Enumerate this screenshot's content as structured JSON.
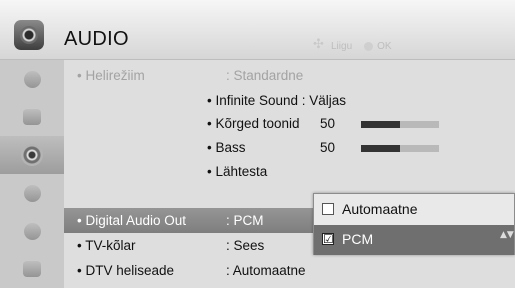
{
  "header": {
    "title": "AUDIO",
    "hint_move": "Liigu",
    "hint_ok": "OK",
    "hint_move_icon": "four-way-arrows-icon",
    "hint_ok_icon": "ok-button-icon"
  },
  "sidebar": {
    "items": [
      {
        "icon": "setup-icon",
        "active": false
      },
      {
        "icon": "picture-icon",
        "active": false
      },
      {
        "icon": "audio-icon",
        "active": true
      },
      {
        "icon": "time-icon",
        "active": false
      },
      {
        "icon": "lock-icon",
        "active": false
      },
      {
        "icon": "option-icon",
        "active": false
      }
    ]
  },
  "menu": {
    "rows": [
      {
        "label": "• Helirežiim",
        "value": ": Standardne",
        "state": "dimmed"
      },
      {
        "label": "• Digital Audio Out",
        "value": ": PCM",
        "state": "selected"
      },
      {
        "label": "• TV-kõlar",
        "value": ": Sees",
        "state": "normal"
      },
      {
        "label": "• DTV heliseade",
        "value": ": Automaatne",
        "state": "normal"
      }
    ],
    "sub_items": [
      {
        "text": "• Infinite Sound : Väljas"
      },
      {
        "text": "• Kõrged toonid",
        "number": "50",
        "level": 50
      },
      {
        "text": "• Bass",
        "number": "50",
        "level": 50
      },
      {
        "text": "• Lähtesta"
      }
    ]
  },
  "popup": {
    "options": [
      {
        "label": "Automaatne",
        "checked": false,
        "selected": false
      },
      {
        "label": "PCM",
        "checked": true,
        "selected": true
      }
    ],
    "check_mark": "☑",
    "empty_box": "",
    "scroll_glyph": "▲▼"
  },
  "colors": {
    "selection": "#8a8a8a",
    "popup_selection": "#6f6f6f",
    "bar_fill": "#333333"
  }
}
